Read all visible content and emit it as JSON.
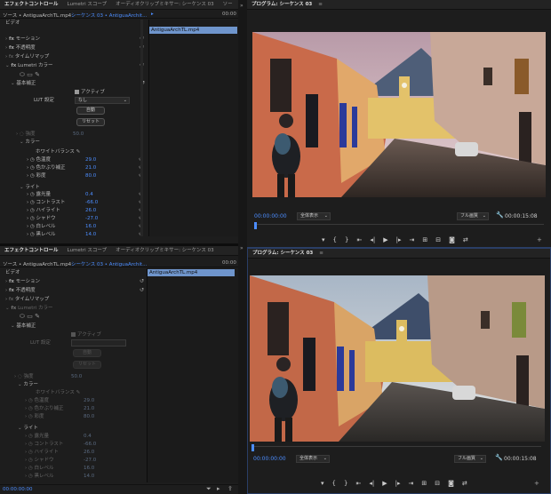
{
  "top_left": {
    "tabs": [
      "エフェクトコントロール",
      "Lumetri スコープ",
      "オーディオクリップミキサー: シーケンス 03",
      "ソー"
    ],
    "source_label": "ソース • AntiguaArchTL.mp4",
    "seq_label": "シーケンス 03 • AntiguaArchit...",
    "time": "00:00",
    "clip_name": "AntiguaArchTL.mp4",
    "video_header": "ビデオ",
    "motion": "モーション",
    "opacity": "不透明度",
    "timeremap": "タイムリマップ",
    "lumetri": "Lumetri カラー",
    "basic": "基本補正",
    "active_label": "アクティブ",
    "lut_label": "LUT 設定",
    "lut_value": "なし",
    "auto_btn": "自動",
    "reset_btn": "リセット",
    "hidden_row": "強度",
    "hidden_val": "50.0",
    "color": "カラー",
    "wb": "ホワイトバランス",
    "light": "ライト",
    "color_params": [
      {
        "label": "色温度",
        "value": "29.0"
      },
      {
        "label": "色かぶり補正",
        "value": "21.0"
      },
      {
        "label": "彩度",
        "value": "80.0"
      }
    ],
    "light_params": [
      {
        "label": "露光量",
        "value": "0.4"
      },
      {
        "label": "コントラスト",
        "value": "-66.0"
      },
      {
        "label": "ハイライト",
        "value": "26.0"
      },
      {
        "label": "シャドウ",
        "value": "-27.0"
      },
      {
        "label": "白レベル",
        "value": "16.0"
      },
      {
        "label": "黒レベル",
        "value": "14.0"
      }
    ]
  },
  "top_right": {
    "title": "プログラム: シーケンス 03",
    "timecode": "00:00:00:00",
    "zoom": "全体表示",
    "quality": "フル画質",
    "duration": "00:00:15:08"
  },
  "bottom_left": {
    "tabs": [
      "エフェクトコントロール",
      "Lumetri スコープ",
      "オーディオクリップミキサー: シーケンス 03"
    ],
    "source_label": "ソース • AntiguaArchTL.mp4",
    "seq_label": "シーケンス 03 • AntiguaArchit...",
    "time": "00:00",
    "clip_name": "AntiguaArchTL.mp4",
    "video_header": "ビデオ",
    "motion": "モーション",
    "opacity": "不透明度",
    "timeremap": "タイムリマップ",
    "lumetri": "Lumetri カラー",
    "basic": "基本補正",
    "active_label": "アクティブ",
    "lut_label": "LUT 設定",
    "auto_btn": "自動",
    "reset_btn": "リセット",
    "hidden_row": "強度",
    "hidden_val": "50.0",
    "color": "カラー",
    "wb": "ホワイトバランス",
    "light": "ライト",
    "color_params": [
      {
        "label": "色温度",
        "value": "29.0"
      },
      {
        "label": "色かぶり補正",
        "value": "21.0"
      },
      {
        "label": "彩度",
        "value": "80.0"
      }
    ],
    "light_params": [
      {
        "label": "露光量",
        "value": "0.4"
      },
      {
        "label": "コントラスト",
        "value": "-66.0"
      },
      {
        "label": "ハイライト",
        "value": "26.0"
      },
      {
        "label": "シャドウ",
        "value": "-27.0"
      },
      {
        "label": "白レベル",
        "value": "16.0"
      },
      {
        "label": "黒レベル",
        "value": "14.0"
      }
    ],
    "bottom_time": "00:00:00:00"
  },
  "bottom_right": {
    "title": "プログラム: シーケンス 03",
    "timecode": "00:00:00:00",
    "zoom": "全体表示",
    "quality": "フル画質",
    "duration": "00:00:15:08"
  },
  "colors": {
    "accent": "#4c8dff",
    "clip": "#6f95cc",
    "panel": "#1d1d1d"
  }
}
